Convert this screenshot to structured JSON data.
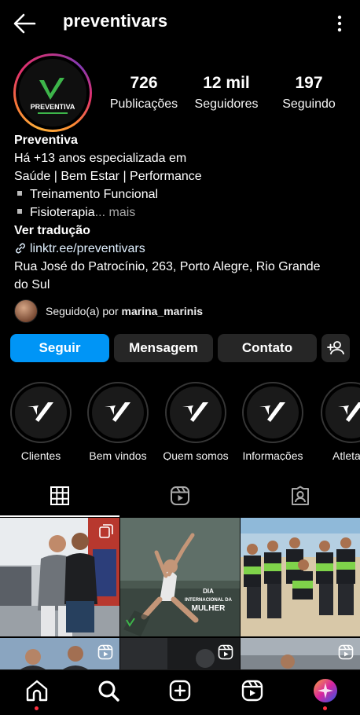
{
  "header": {
    "username": "preventivars"
  },
  "stats": [
    {
      "value": "726",
      "label": "Publicações"
    },
    {
      "value": "12 mil",
      "label": "Seguidores"
    },
    {
      "value": "197",
      "label": "Seguindo"
    }
  ],
  "avatar": {
    "brand_text": "PREVENTIVA"
  },
  "bio": {
    "name": "Preventiva",
    "line1": "Há +13 anos especializada em",
    "line2": "Saúde | Bem Estar | Performance",
    "bullet1": "Treinamento Funcional",
    "bullet2": "Fisioterapia",
    "more": "... mais",
    "translate": "Ver tradução",
    "link": "linktr.ee/preventivars",
    "address1": "Rua José do Patrocínio, 263, Porto Alegre, Rio Grande",
    "address2": "do Sul"
  },
  "followed_by": {
    "prefix": "Seguido(a) por ",
    "user": "marina_marinis"
  },
  "buttons": {
    "follow": "Seguir",
    "message": "Mensagem",
    "contact": "Contato"
  },
  "highlights": [
    {
      "label": "Clientes"
    },
    {
      "label": "Bem vindos"
    },
    {
      "label": "Quem somos"
    },
    {
      "label": "Informações"
    },
    {
      "label": "Atleta"
    }
  ],
  "posts": {
    "post2_caption1": "DIA",
    "post2_caption2": "INTERNACIONAL DA",
    "post2_caption3": "MULHER"
  },
  "colors": {
    "accent": "#0095f6",
    "brand_green": "#3db54a",
    "notification": "#ff3040"
  },
  "icons": [
    "back-arrow-icon",
    "more-vertical-icon",
    "link-icon",
    "add-user-icon",
    "grid-icon",
    "reels-icon",
    "tagged-icon",
    "home-icon",
    "search-icon",
    "create-icon",
    "reels-nav-icon",
    "profile-avatar-icon"
  ]
}
